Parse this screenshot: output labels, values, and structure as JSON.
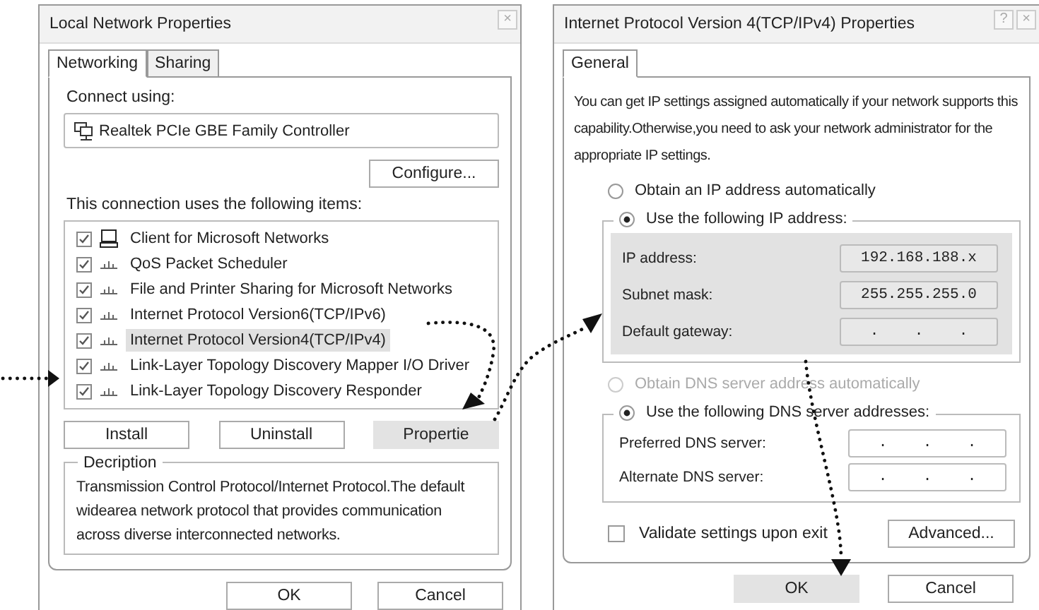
{
  "left_dialog": {
    "title": "Local Network Properties",
    "title_buttons": [
      "×"
    ],
    "tabs": [
      {
        "label": "Networking",
        "selected": true
      },
      {
        "label": "Sharing",
        "selected": false
      }
    ],
    "connect_using_label": "Connect using:",
    "adapter": "Realtek PCIe GBE Family Controller",
    "configure_button": "Configure...",
    "items_label": "This connection uses the following items:",
    "items": [
      {
        "label": "Client for Microsoft Networks",
        "kind": "client",
        "checked": true,
        "selected": false
      },
      {
        "label": "QoS Packet Scheduler",
        "kind": "service",
        "checked": true,
        "selected": false
      },
      {
        "label": "File and Printer Sharing for Microsoft Networks",
        "kind": "service",
        "checked": true,
        "selected": false
      },
      {
        "label": "Internet Protocol Version6(TCP/IPv6)",
        "kind": "service",
        "checked": true,
        "selected": false
      },
      {
        "label": "Internet Protocol Version4(TCP/IPv4)",
        "kind": "service",
        "checked": true,
        "selected": true
      },
      {
        "label": "Link-Layer Topology Discovery Mapper I/O Driver",
        "kind": "service",
        "checked": true,
        "selected": false
      },
      {
        "label": "Link-Layer Topology Discovery Responder",
        "kind": "service",
        "checked": true,
        "selected": false
      }
    ],
    "buttons": [
      {
        "label": "Install",
        "selected": false
      },
      {
        "label": "Uninstall",
        "selected": false
      },
      {
        "label": "Propertie",
        "selected": true
      }
    ],
    "description": {
      "legend": "Decription",
      "text": "Transmission Control Protocol/Internet Protocol.The default widearea network protocol that provides communication across diverse interconnected networks."
    },
    "footer_buttons": [
      {
        "label": "OK",
        "selected": false
      },
      {
        "label": "Cancel",
        "selected": false
      }
    ]
  },
  "right_dialog": {
    "title": "Internet Protocol Version 4(TCP/IPv4) Properties",
    "title_buttons": [
      "?",
      "×"
    ],
    "tabs": [
      {
        "label": "General",
        "selected": true
      }
    ],
    "intro": "You can get IP settings assigned automatically if your network supports this capability.Otherwise,you need to ask your network administrator for the appropriate IP settings.",
    "ip_options": [
      {
        "label": "Obtain an IP address automatically",
        "selected": false,
        "disabled": false
      },
      {
        "label": "Use the following IP address:",
        "selected": true,
        "disabled": false
      }
    ],
    "ip_fields": [
      {
        "label": "IP address:",
        "value": "192.168.188.x"
      },
      {
        "label": "Subnet mask:",
        "value": "255.255.255.0"
      },
      {
        "label": "Default gateway:",
        "value": ".    .    ."
      }
    ],
    "dns_options": [
      {
        "label": "Obtain DNS server address automatically",
        "selected": false,
        "disabled": true
      },
      {
        "label": "Use the following DNS server addresses:",
        "selected": true,
        "disabled": false
      }
    ],
    "dns_fields": [
      {
        "label": "Preferred DNS server:",
        "value": ".    .    ."
      },
      {
        "label": "Alternate DNS server:",
        "value": ".    .    ."
      }
    ],
    "validate": {
      "label": "Validate settings upon exit",
      "checked": false
    },
    "advanced_button": "Advanced...",
    "footer_buttons": [
      {
        "label": "OK",
        "selected": true
      },
      {
        "label": "Cancel",
        "selected": false
      }
    ]
  }
}
